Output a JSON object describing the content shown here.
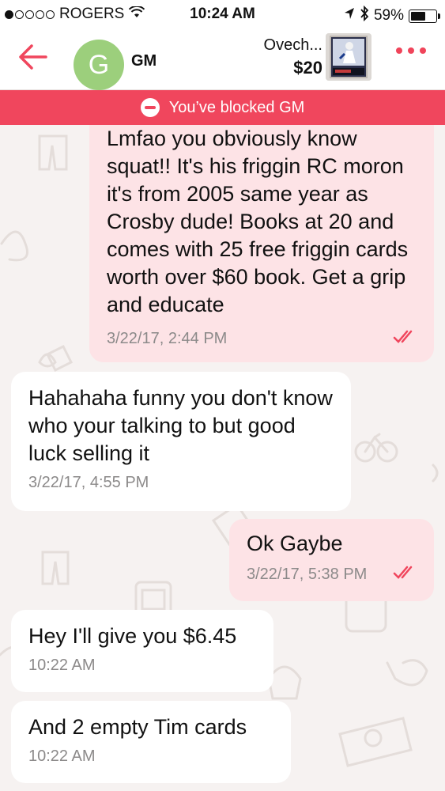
{
  "status_bar": {
    "carrier": "ROGERS",
    "time": "10:24 AM",
    "battery": "59%",
    "battery_level": 0.59,
    "icons": [
      "signal-dots-icon",
      "wifi-icon",
      "location-arrow-icon",
      "bluetooth-icon",
      "battery-icon"
    ]
  },
  "header": {
    "back_icon": "arrow-left-icon",
    "avatar_letter": "G",
    "contact_name": "GM",
    "item_title": "Ovech...",
    "item_price": "$20",
    "more_icon": "more-dots-icon"
  },
  "banner": {
    "text": "You’ve blocked GM",
    "icon": "blocked-icon"
  },
  "messages": [
    {
      "direction": "out",
      "text": "Lmfao you obviously know squat!! It's his friggin RC moron it's from 2005 same year as Crosby dude! Books at 20 and comes with 25 free friggin cards worth over $60 book. Get a grip and educate",
      "time": "3/22/17, 2:44 PM",
      "read": true
    },
    {
      "direction": "in",
      "text": "Hahahaha funny you don't know who your talking to but good luck selling it",
      "time": "3/22/17, 4:55 PM"
    },
    {
      "direction": "out",
      "text": "Ok Gaybe",
      "time": "3/22/17, 5:38 PM",
      "read": true
    },
    {
      "direction": "in",
      "text": "Hey I'll give you $6.45",
      "time": "10:22 AM"
    },
    {
      "direction": "in",
      "text": "And 2 empty Tim cards",
      "time": "10:22 AM"
    }
  ],
  "colors": {
    "accent": "#f0465d",
    "outgoing_bubble": "#fde3e6",
    "incoming_bubble": "#ffffff",
    "avatar": "#9ccf7c",
    "background": "#f6f2f1"
  }
}
